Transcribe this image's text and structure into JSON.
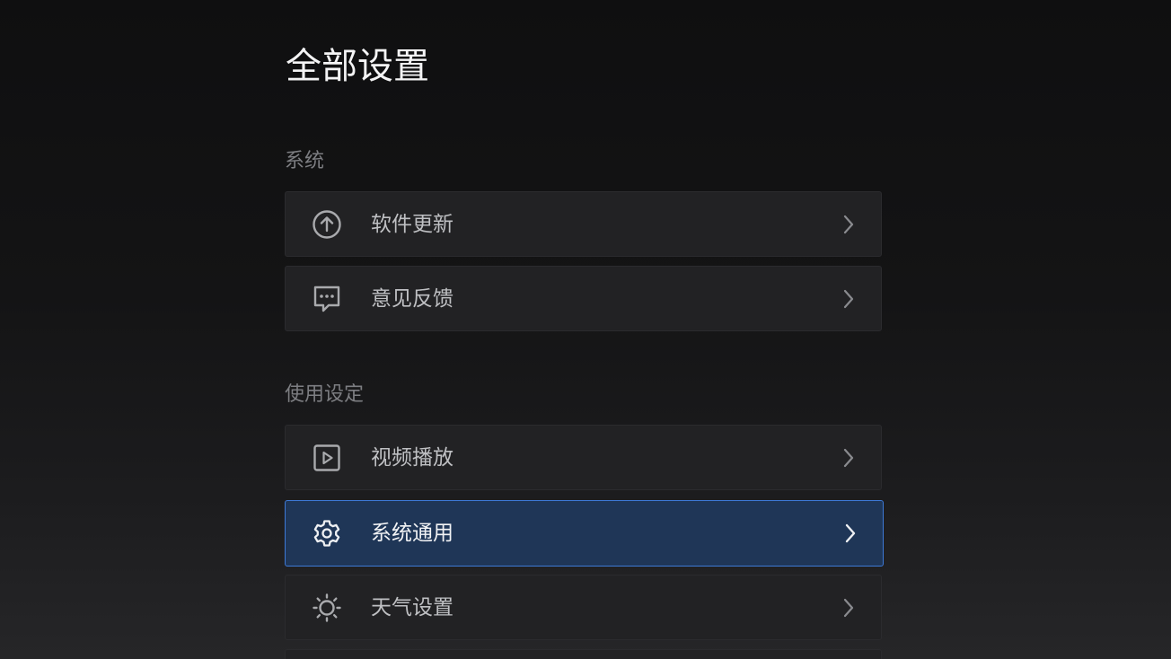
{
  "page": {
    "title": "全部设置"
  },
  "sections": [
    {
      "label": "系统",
      "items": [
        {
          "label": "软件更新",
          "icon": "upload-circle-icon"
        },
        {
          "label": "意见反馈",
          "icon": "feedback-message-icon"
        }
      ]
    },
    {
      "label": "使用设定",
      "items": [
        {
          "label": "视频播放",
          "icon": "video-play-icon"
        },
        {
          "label": "系统通用",
          "icon": "gear-icon",
          "selected": true
        },
        {
          "label": "天气设置",
          "icon": "sun-icon"
        }
      ]
    }
  ],
  "colors": {
    "selected_background": "#1f3657",
    "selected_border": "#3d79d6",
    "item_background": "#222224"
  }
}
